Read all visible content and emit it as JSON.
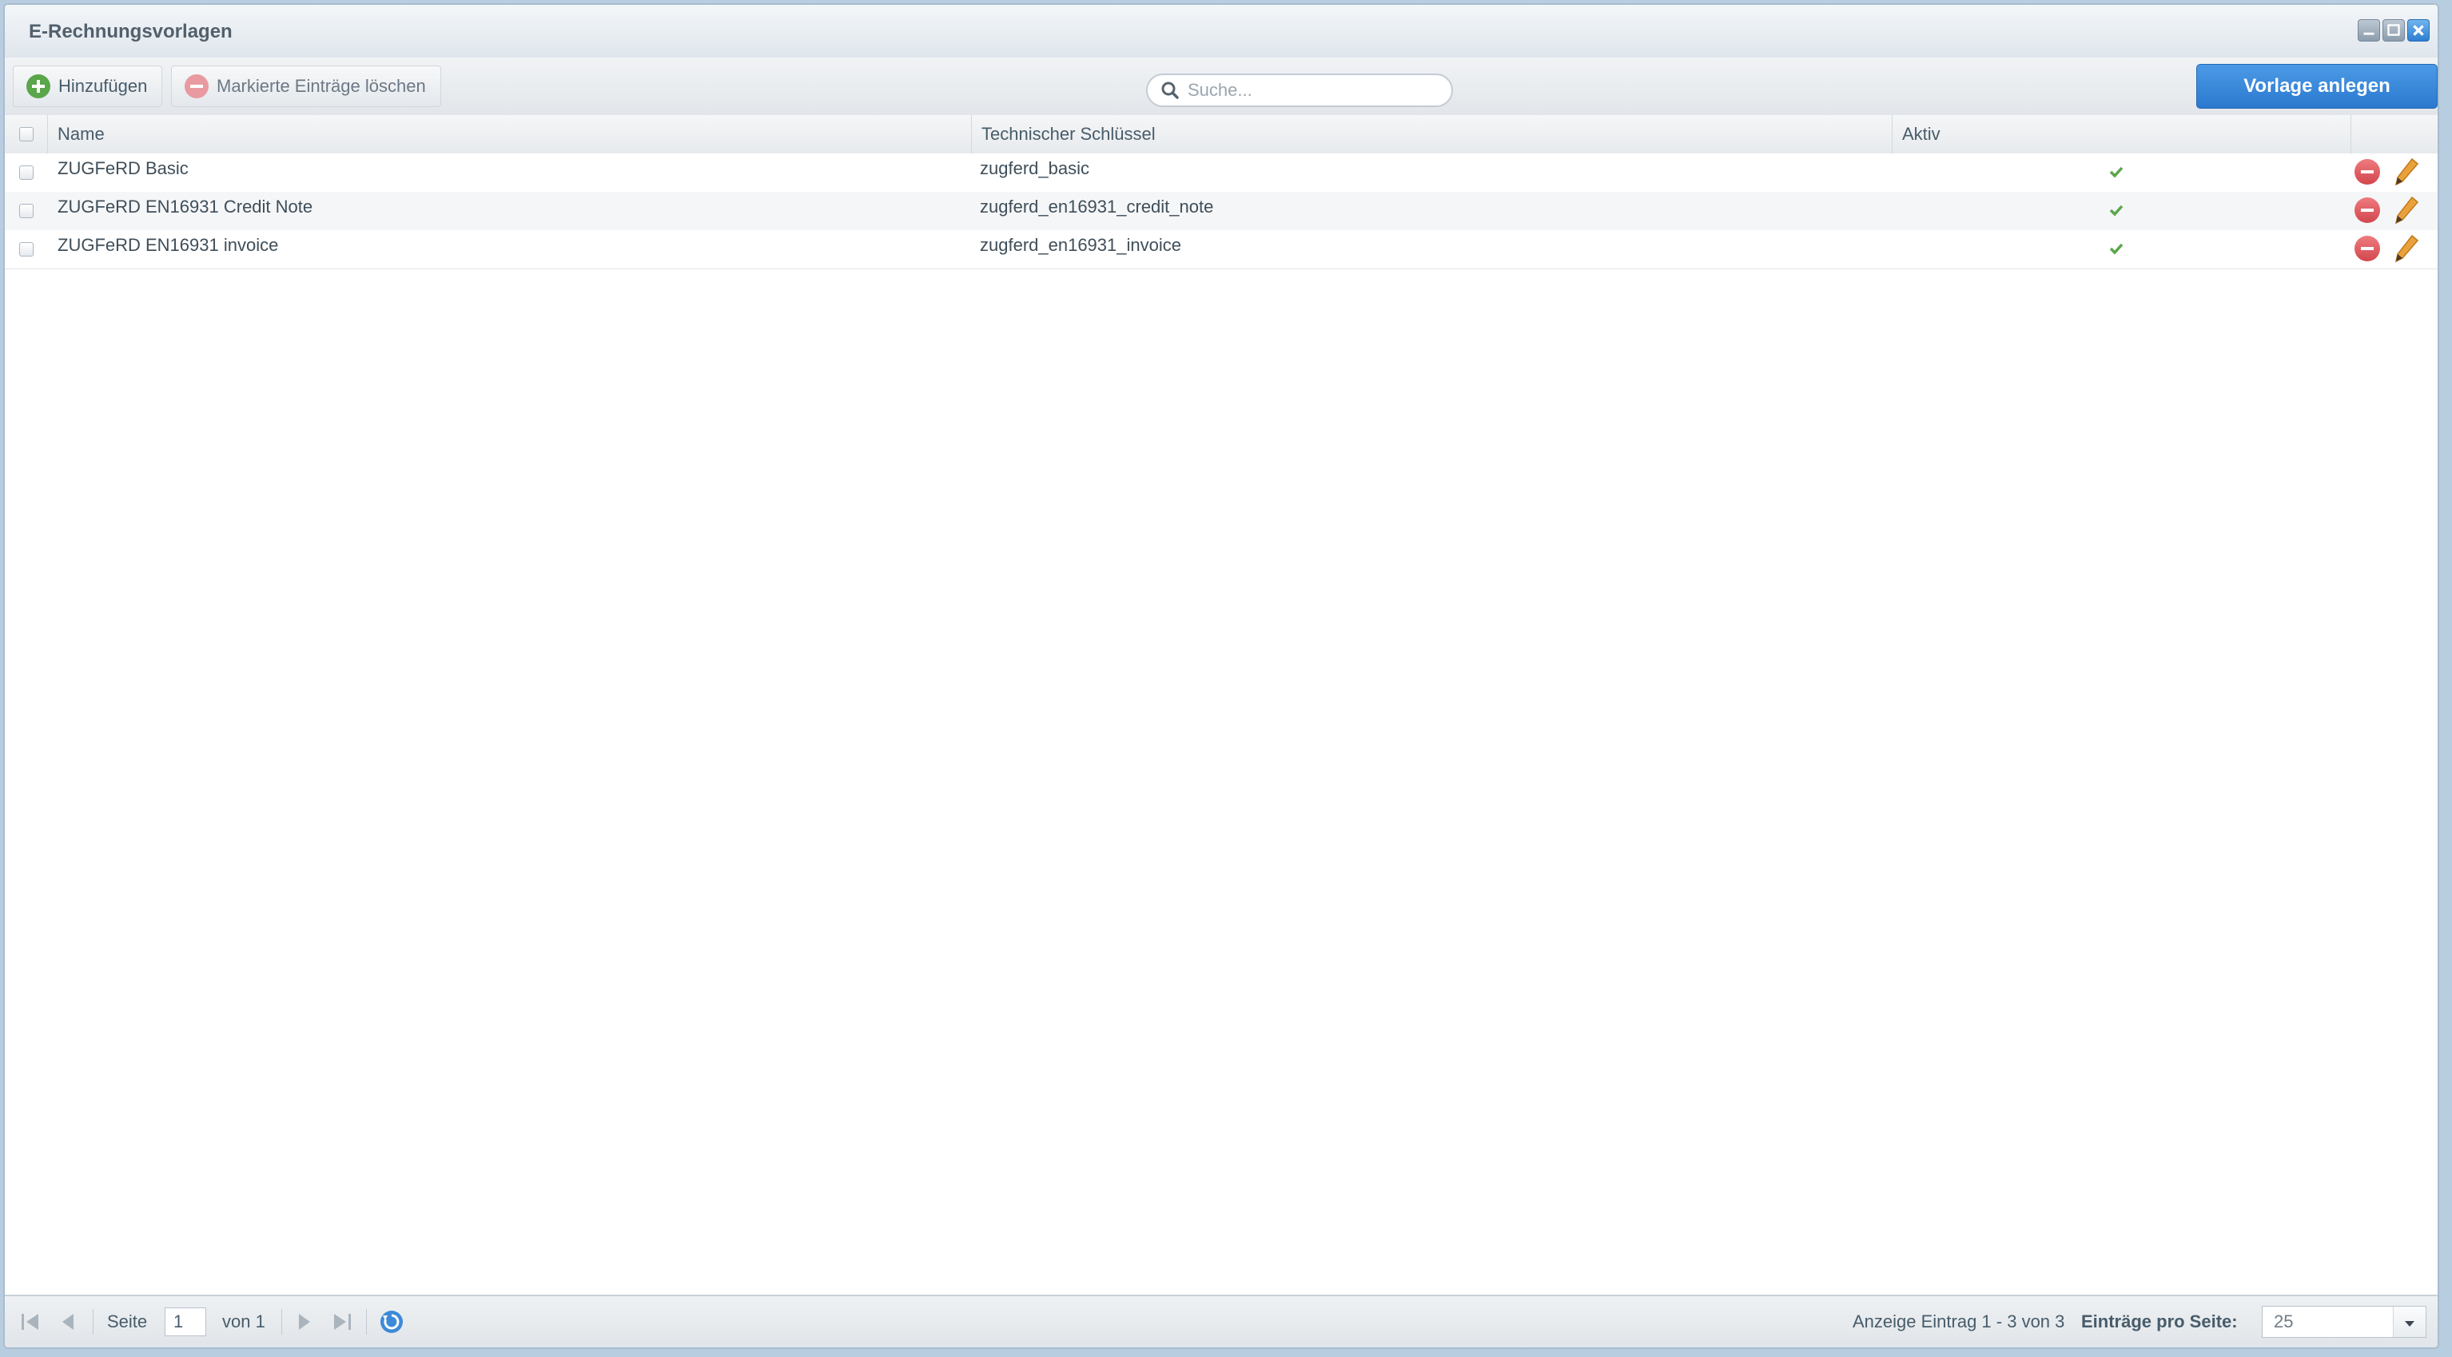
{
  "window": {
    "title": "E-Rechnungsvorlagen"
  },
  "toolbar": {
    "add_label": "Hinzufügen",
    "delete_label": "Markierte Einträge löschen",
    "search_placeholder": "Suche...",
    "create_label": "Vorlage anlegen"
  },
  "grid": {
    "columns": {
      "name": "Name",
      "key": "Technischer Schlüssel",
      "active": "Aktiv"
    },
    "rows": [
      {
        "name": "ZUGFeRD Basic",
        "key": "zugferd_basic",
        "active": true
      },
      {
        "name": "ZUGFeRD EN16931 Credit Note",
        "key": "zugferd_en16931_credit_note",
        "active": true
      },
      {
        "name": "ZUGFeRD EN16931 invoice",
        "key": "zugferd_en16931_invoice",
        "active": true
      }
    ]
  },
  "pager": {
    "page_label": "Seite",
    "page_value": "1",
    "of_label": "von 1",
    "display_info": "Anzeige Eintrag 1 - 3 von 3",
    "per_page_label": "Einträge pro Seite:",
    "per_page_value": "25"
  },
  "colors": {
    "primary": "#2a79cf",
    "add_green": "#5aa64a",
    "delete_red": "#d2474d",
    "edit_orange": "#e9a23b",
    "check_green": "#5aa64a"
  }
}
